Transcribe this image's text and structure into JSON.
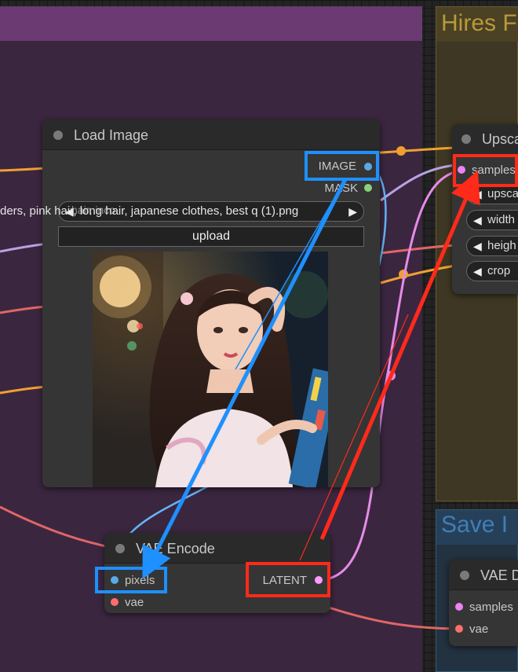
{
  "canvas": {
    "background": "#232323"
  },
  "groups": {
    "left_group": {
      "title": "",
      "color": "#3b2640",
      "header_color": "#6b3a72"
    },
    "hires_group": {
      "title": "Hires F",
      "color": "#3e3723",
      "title_color": "#b89a3a"
    },
    "save_group": {
      "title": "Save I",
      "color": "#233240",
      "title_color": "#3e7fb8"
    }
  },
  "load_image_node": {
    "title": "Load Image",
    "outputs": [
      {
        "label": "IMAGE",
        "color": "#5aa9e6"
      },
      {
        "label": "MASK",
        "color": "#8bd17c"
      }
    ],
    "filename_widget": "ders, pink hair, long hair, japanese clothes, best q (1).png",
    "filename_overlap": "hair, inco",
    "upload_label": "upload",
    "preview": "image-preview-girl-with-painting"
  },
  "upscale_node": {
    "title": "Upsca",
    "inputs": [
      {
        "label": "samples",
        "color": "#ee82ee"
      }
    ],
    "widgets": [
      "upscal",
      "width",
      "heigh",
      "crop"
    ]
  },
  "vae_encode_node": {
    "title": "VAE Encode",
    "inputs": [
      {
        "label": "pixels",
        "color": "#5aa9e6"
      },
      {
        "label": "vae",
        "color": "#ff6e6e"
      }
    ],
    "outputs": [
      {
        "label": "LATENT",
        "color": "#ff9cf9"
      }
    ]
  },
  "vae_decode_node": {
    "title": "VAE D",
    "inputs": [
      {
        "label": "samples",
        "color": "#ee82ee"
      },
      {
        "label": "vae",
        "color": "#ff6e6e"
      }
    ]
  },
  "highlights": {
    "blue": "#1e90ff",
    "red": "#ff2a1a"
  },
  "wire_colors": {
    "image": "#64b5f6",
    "latent": "#e58be8",
    "vae": "#e06666",
    "orange": "#f0a030",
    "purple": "#b7a2e0"
  }
}
